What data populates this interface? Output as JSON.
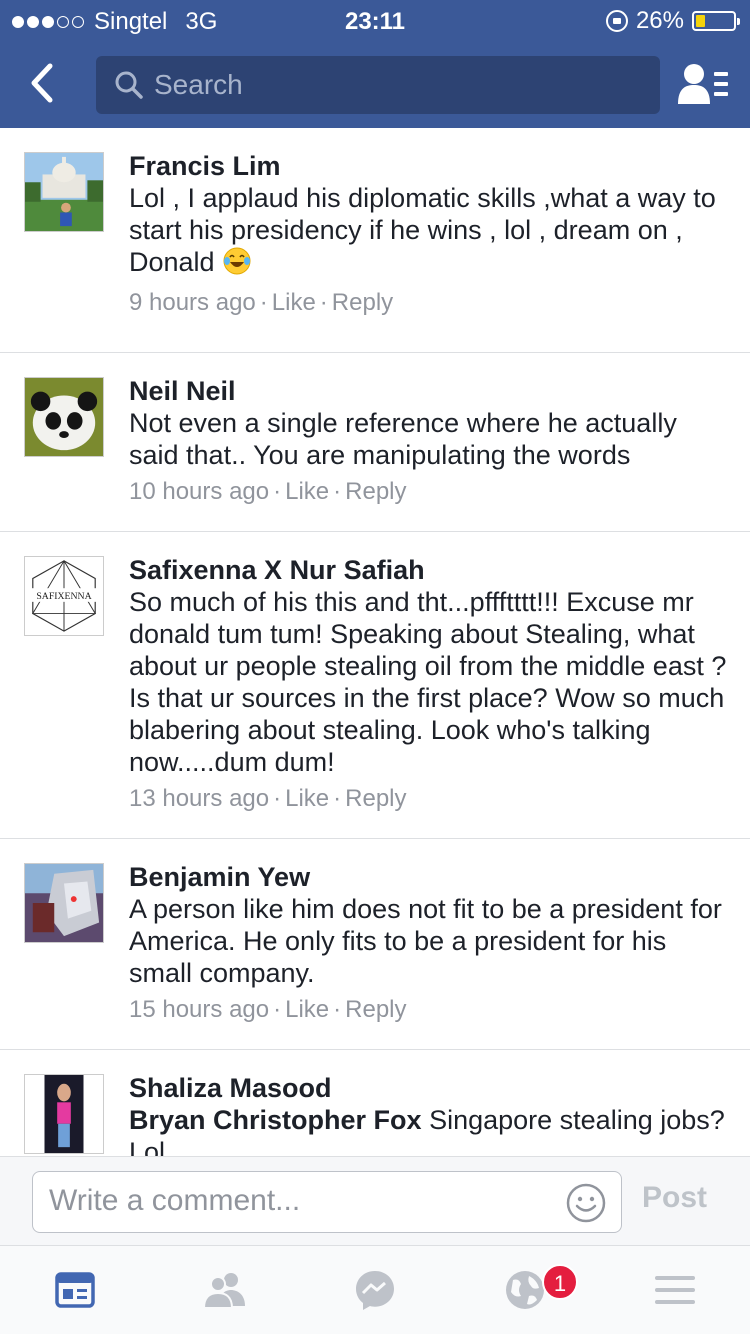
{
  "status_bar": {
    "carrier": "Singtel",
    "network": "3G",
    "time": "23:11",
    "battery": "26%",
    "battery_level": 0.26,
    "signal_bars_filled": 3,
    "signal_bars_total": 5
  },
  "nav": {
    "search_placeholder": "Search",
    "back_icon": "chevron-left-icon",
    "friends_icon": "friend-requests-icon"
  },
  "comments": [
    {
      "name": "Francis Lim",
      "text": "Lol , I applaud his diplomatic skills ,what a way to start his presidency if he wins , lol , dream on , Donald",
      "emoji": "laughing-tears-emoji",
      "time": "9 hours ago",
      "like": "Like",
      "reply": "Reply"
    },
    {
      "name": "Neil Neil",
      "text": "Not even a single reference where he actually said that.. You are manipulating the words",
      "time": "10 hours ago",
      "like": "Like",
      "reply": "Reply"
    },
    {
      "name": "Safixenna X Nur Safiah",
      "avatar_text": "SAFIXENNA",
      "text": "So much of his this and tht...pffftttt!!! Excuse mr donald tum tum! Speaking about Stealing, what about ur people stealing oil from the middle east ? Is that ur sources in the first place? Wow so much blabering about stealing. Look who's talking now.....dum dum!",
      "time": "13 hours ago",
      "like": "Like",
      "reply": "Reply"
    },
    {
      "name": "Benjamin Yew",
      "text": "A person like him does not fit to be a president for America. He only fits to be a president for his small company.",
      "time": "15 hours ago",
      "like": "Like",
      "reply": "Reply"
    },
    {
      "name": "Shaliza Masood",
      "mention": "Bryan Christopher Fox",
      "text": "Singapore stealing jobs? Lol"
    }
  ],
  "composer": {
    "placeholder": "Write a comment...",
    "post_label": "Post",
    "emoji_icon": "smiley-icon"
  },
  "tabs": {
    "items": [
      "news-feed-icon",
      "friends-icon",
      "messenger-icon",
      "notifications-globe-icon",
      "menu-icon"
    ],
    "notification_badge": "1",
    "active_color": "#4267b2",
    "inactive_color": "#bec2c9"
  },
  "colors": {
    "brand": "#3b5998",
    "search_bg": "#2d4373",
    "meta_text": "#90949c",
    "badge": "#e41e3f"
  }
}
